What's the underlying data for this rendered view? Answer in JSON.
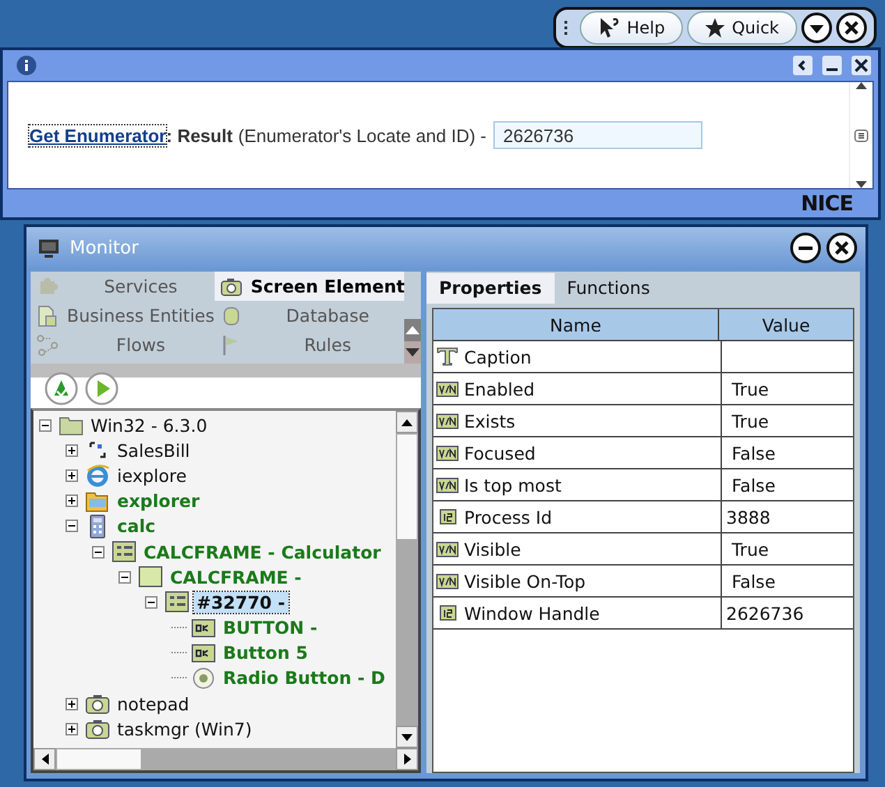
{
  "toolbar": {
    "buttons": [
      {
        "label": "Help",
        "kind": "help"
      },
      {
        "label": "Quick",
        "kind": "quick"
      }
    ]
  },
  "info_panel": {
    "link": "Get Enumerator",
    "result_label": ": Result",
    "description": "(Enumerator's Locate and ID) -",
    "value": "2626736",
    "logo": "NICE"
  },
  "monitor": {
    "title": "Monitor",
    "categories": [
      {
        "label": "Services",
        "kind": "puzzle",
        "selected": false
      },
      {
        "label": "Screen Element",
        "kind": "camera",
        "selected": true
      },
      {
        "label": "Business Entities",
        "kind": "doc",
        "selected": false
      },
      {
        "label": "Database",
        "kind": "db",
        "selected": false
      },
      {
        "label": "Flows",
        "kind": "flow",
        "selected": false
      },
      {
        "label": "Rules",
        "kind": "flag",
        "selected": false
      }
    ],
    "tree": [
      {
        "label": "Win32 - 6.3.0",
        "kind": "folder",
        "highlighted": false,
        "selected": false,
        "expanded": true,
        "children": [
          {
            "label": "SalesBill",
            "kind": "bracket",
            "highlighted": false,
            "selected": false,
            "expanded": false
          },
          {
            "label": "iexplore",
            "kind": "ie",
            "highlighted": false,
            "selected": false,
            "expanded": false
          },
          {
            "label": "explorer",
            "kind": "openfolder",
            "highlighted": true,
            "selected": false,
            "expanded": false
          },
          {
            "label": "calc",
            "kind": "calc",
            "highlighted": true,
            "selected": false,
            "expanded": true,
            "children": [
              {
                "label": "CALCFRAME - Calculator",
                "kind": "form",
                "highlighted": true,
                "selected": false,
                "expanded": true,
                "children": [
                  {
                    "label": "CALCFRAME -",
                    "kind": "window",
                    "highlighted": true,
                    "selected": false,
                    "expanded": true,
                    "children": [
                      {
                        "label": "#32770 -",
                        "kind": "form",
                        "highlighted": false,
                        "selected": true,
                        "expanded": true,
                        "children": [
                          {
                            "label": "BUTTON -",
                            "kind": "ok",
                            "highlighted": true,
                            "selected": false
                          },
                          {
                            "label": "Button 5",
                            "kind": "ok",
                            "highlighted": true,
                            "selected": false
                          },
                          {
                            "label": "Radio Button - D",
                            "kind": "radio",
                            "highlighted": true,
                            "selected": false
                          }
                        ]
                      }
                    ]
                  }
                ]
              }
            ]
          },
          {
            "label": "notepad",
            "kind": "camera",
            "highlighted": false,
            "selected": false,
            "expanded": false
          },
          {
            "label": "taskmgr (Win7)",
            "kind": "camera",
            "highlighted": false,
            "selected": false,
            "expanded": false
          }
        ]
      }
    ],
    "detail_tabs": [
      {
        "label": "Properties",
        "selected": true
      },
      {
        "label": "Functions",
        "selected": false
      }
    ],
    "properties": {
      "columns": [
        "Name",
        "Value"
      ],
      "rows": [
        {
          "kind": "text",
          "name": "Caption"
        },
        {
          "kind": "bool",
          "name": "Enabled",
          "value": "True"
        },
        {
          "kind": "bool",
          "name": "Exists",
          "value": "True"
        },
        {
          "kind": "bool",
          "name": "Focused",
          "value": "False"
        },
        {
          "kind": "bool",
          "name": "Is top most",
          "value": "False"
        },
        {
          "kind": "number",
          "name": "Process Id",
          "value": "3888"
        },
        {
          "kind": "bool",
          "name": "Visible",
          "value": "True"
        },
        {
          "kind": "bool",
          "name": "Visible On-Top",
          "value": "False"
        },
        {
          "kind": "number",
          "name": "Window Handle",
          "value": "2626736"
        }
      ]
    }
  }
}
